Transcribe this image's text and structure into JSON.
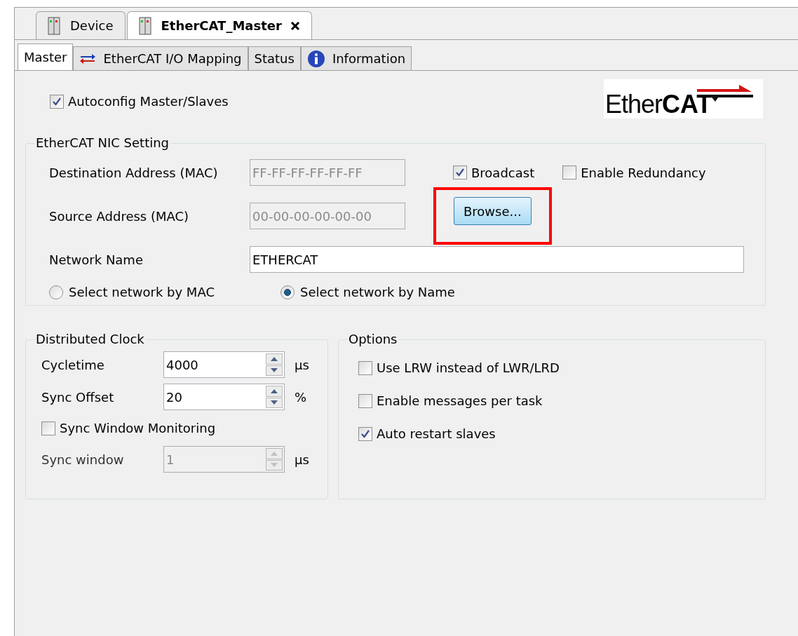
{
  "document_tabs": [
    {
      "label": "Device",
      "selected": false,
      "closable": false
    },
    {
      "label": "EtherCAT_Master",
      "selected": true,
      "closable": true
    }
  ],
  "tabs": [
    {
      "label": "Master",
      "selected": true,
      "kind": "plain"
    },
    {
      "label": "EtherCAT I/O Mapping",
      "selected": false,
      "kind": "mapping"
    },
    {
      "label": "Status",
      "selected": false,
      "kind": "plain"
    },
    {
      "label": "Information",
      "selected": false,
      "kind": "info"
    }
  ],
  "autoconfig": {
    "label": "Autoconfig Master/Slaves",
    "checked": true
  },
  "logo": {
    "text_light": "Ether",
    "text_bold": "CAT"
  },
  "nic_setting": {
    "title": "EtherCAT NIC Setting",
    "destination": {
      "label": "Destination Address (MAC)",
      "value": "FF-FF-FF-FF-FF-FF",
      "disabled": true
    },
    "source": {
      "label": "Source Address (MAC)",
      "value": "00-00-00-00-00-00",
      "disabled": true
    },
    "broadcast": {
      "label": "Broadcast",
      "checked": true
    },
    "redundancy": {
      "label": "Enable Redundancy",
      "checked": false
    },
    "browse": {
      "label": "Browse...",
      "highlighted": true
    },
    "network_name": {
      "label": "Network Name",
      "value": "ETHERCAT",
      "disabled": false
    },
    "select_by": [
      {
        "label": "Select network by MAC",
        "selected": false
      },
      {
        "label": "Select network by Name",
        "selected": true
      }
    ]
  },
  "distributed_clock": {
    "title": "Distributed Clock",
    "rows": [
      {
        "label": "Cycletime",
        "value": "4000",
        "unit": "µs",
        "disabled": false
      },
      {
        "label": "Sync Offset",
        "value": "20",
        "unit": "%",
        "disabled": false
      }
    ],
    "monitoring": {
      "label": "Sync Window Monitoring",
      "checked": false
    },
    "window": {
      "label": "Sync window",
      "value": "1",
      "unit": "µs",
      "disabled": true
    }
  },
  "options": {
    "title": "Options",
    "items": [
      {
        "label": "Use LRW instead of LWR/LRD",
        "checked": false
      },
      {
        "label": "Enable messages per task",
        "checked": false
      },
      {
        "label": "Auto restart slaves",
        "checked": true
      }
    ]
  }
}
